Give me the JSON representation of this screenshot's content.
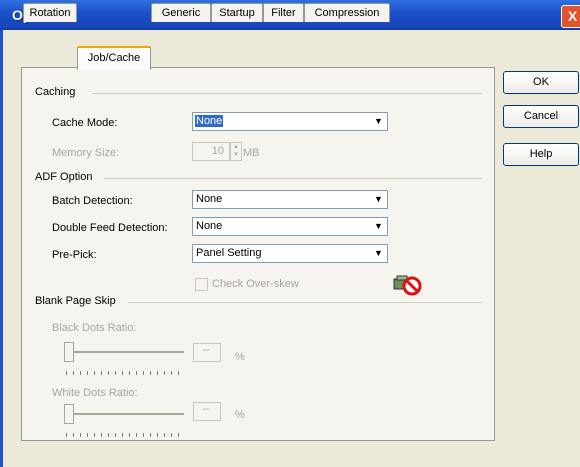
{
  "window": {
    "title": "Option",
    "close": "X"
  },
  "tabs": [
    {
      "label": "Rotation"
    },
    {
      "label": "Job/Cache"
    },
    {
      "label": "Generic"
    },
    {
      "label": "Startup"
    },
    {
      "label": "Filter"
    },
    {
      "label": "Compression"
    }
  ],
  "caching": {
    "group": "Caching",
    "cache_mode_label": "Cache Mode:",
    "cache_mode_value": "None",
    "memory_label": "Memory Size:",
    "memory_value": "10",
    "memory_unit": "MB"
  },
  "adf": {
    "group": "ADF Option",
    "batch_label": "Batch Detection:",
    "batch_value": "None",
    "double_label": "Double Feed Detection:",
    "double_value": "None",
    "prepick_label": "Pre-Pick:",
    "prepick_value": "Panel Setting",
    "check_overskew": "Check Over-skew"
  },
  "blank": {
    "group": "Blank Page Skip",
    "black_label": "Black Dots Ratio:",
    "white_label": "White Dots Ratio:",
    "unit": "%"
  },
  "buttons": {
    "ok": "OK",
    "cancel": "Cancel",
    "help": "Help"
  }
}
